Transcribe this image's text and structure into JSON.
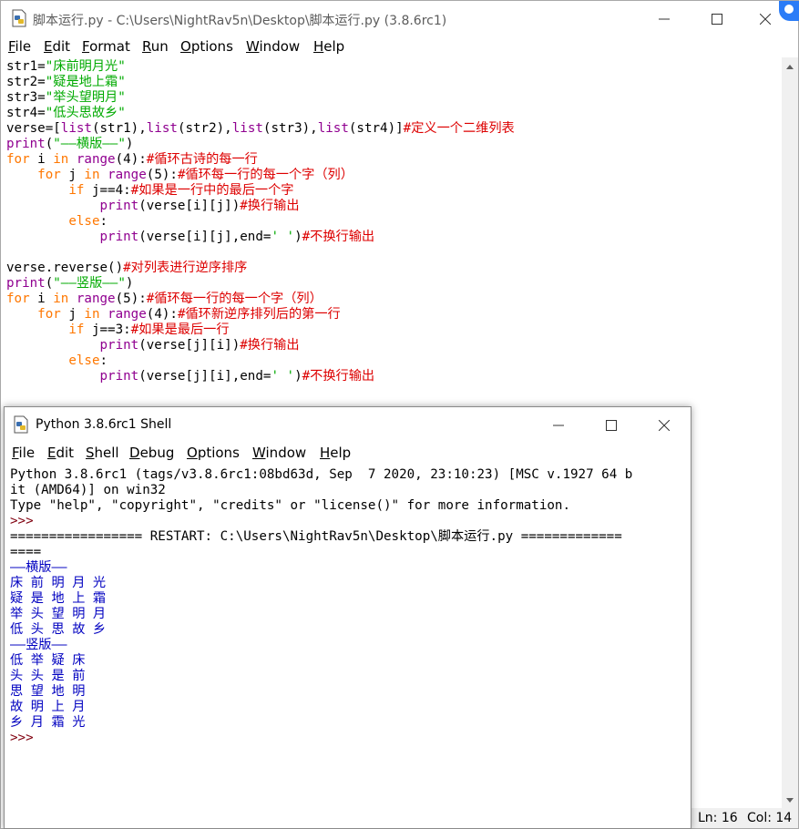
{
  "editor": {
    "title": "脚本运行.py - C:\\Users\\NightRav5n\\Desktop\\脚本运行.py (3.8.6rc1)",
    "menu": [
      "File",
      "Edit",
      "Format",
      "Run",
      "Options",
      "Window",
      "Help"
    ],
    "status": {
      "line": "Ln: 16",
      "col": "Col: 14"
    },
    "code": [
      [
        [
          "",
          "str1="
        ],
        [
          "st",
          "\"床前明月光\""
        ]
      ],
      [
        [
          "",
          "str2="
        ],
        [
          "st",
          "\"疑是地上霜\""
        ]
      ],
      [
        [
          "",
          "str3="
        ],
        [
          "st",
          "\"举头望明月\""
        ]
      ],
      [
        [
          "",
          "str4="
        ],
        [
          "st",
          "\"低头思故乡\""
        ]
      ],
      [
        [
          "",
          "verse=["
        ],
        [
          "bi",
          "list"
        ],
        [
          "",
          "(str1),"
        ],
        [
          "bi",
          "list"
        ],
        [
          "",
          "(str2),"
        ],
        [
          "bi",
          "list"
        ],
        [
          "",
          "(str3),"
        ],
        [
          "bi",
          "list"
        ],
        [
          "",
          "(str4)]"
        ],
        [
          "cm",
          "#定义一个二维列表"
        ]
      ],
      [
        [
          "bi",
          "print"
        ],
        [
          "",
          "("
        ],
        [
          "st",
          "\"——横版——\""
        ],
        [
          "",
          ")"
        ]
      ],
      [
        [
          "kw",
          "for"
        ],
        [
          "",
          " i "
        ],
        [
          "kw",
          "in"
        ],
        [
          "",
          " "
        ],
        [
          "bi",
          "range"
        ],
        [
          "",
          "(4):"
        ],
        [
          "cm",
          "#循环古诗的每一行"
        ]
      ],
      [
        [
          "",
          "    "
        ],
        [
          "kw",
          "for"
        ],
        [
          "",
          " j "
        ],
        [
          "kw",
          "in"
        ],
        [
          "",
          " "
        ],
        [
          "bi",
          "range"
        ],
        [
          "",
          "(5):"
        ],
        [
          "cm",
          "#循环每一行的每一个字（列）"
        ]
      ],
      [
        [
          "",
          "        "
        ],
        [
          "kw",
          "if"
        ],
        [
          "",
          " j==4:"
        ],
        [
          "cm",
          "#如果是一行中的最后一个字"
        ]
      ],
      [
        [
          "",
          "            "
        ],
        [
          "bi",
          "print"
        ],
        [
          "",
          "(verse[i][j])"
        ],
        [
          "cm",
          "#换行输出"
        ]
      ],
      [
        [
          "",
          "        "
        ],
        [
          "kw",
          "else"
        ],
        [
          "",
          ":"
        ]
      ],
      [
        [
          "",
          "            "
        ],
        [
          "bi",
          "print"
        ],
        [
          "",
          "(verse[i][j],end="
        ],
        [
          "st",
          "' '"
        ],
        [
          "",
          ")"
        ],
        [
          "cm",
          "#不换行输出"
        ]
      ],
      [
        [
          "",
          ""
        ]
      ],
      [
        [
          "",
          "verse.reverse()"
        ],
        [
          "cm",
          "#对列表进行逆序排序"
        ]
      ],
      [
        [
          "bi",
          "print"
        ],
        [
          "",
          "("
        ],
        [
          "st",
          "\"——竖版——\""
        ],
        [
          "",
          ")"
        ]
      ],
      [
        [
          "kw",
          "for"
        ],
        [
          "",
          " i "
        ],
        [
          "kw",
          "in"
        ],
        [
          "",
          " "
        ],
        [
          "bi",
          "range"
        ],
        [
          "",
          "(5):"
        ],
        [
          "cm",
          "#循环每一行的每一个字（列）"
        ]
      ],
      [
        [
          "",
          "    "
        ],
        [
          "kw",
          "for"
        ],
        [
          "",
          " j "
        ],
        [
          "kw",
          "in"
        ],
        [
          "",
          " "
        ],
        [
          "bi",
          "range"
        ],
        [
          "",
          "(4):"
        ],
        [
          "cm",
          "#循环新逆序排列后的第一行"
        ]
      ],
      [
        [
          "",
          "        "
        ],
        [
          "kw",
          "if"
        ],
        [
          "",
          " j==3:"
        ],
        [
          "cm",
          "#如果是最后一行"
        ]
      ],
      [
        [
          "",
          "            "
        ],
        [
          "bi",
          "print"
        ],
        [
          "",
          "(verse[j][i])"
        ],
        [
          "cm",
          "#换行输出"
        ]
      ],
      [
        [
          "",
          "        "
        ],
        [
          "kw",
          "else"
        ],
        [
          "",
          ":"
        ]
      ],
      [
        [
          "",
          "            "
        ],
        [
          "bi",
          "print"
        ],
        [
          "",
          "(verse[j][i],end="
        ],
        [
          "st",
          "' '"
        ],
        [
          "",
          ")"
        ],
        [
          "cm",
          "#不换行输出"
        ]
      ]
    ]
  },
  "shell": {
    "title": "Python 3.8.6rc1 Shell",
    "menu": [
      "File",
      "Edit",
      "Shell",
      "Debug",
      "Options",
      "Window",
      "Help"
    ],
    "output": [
      [
        "",
        "Python 3.8.6rc1 (tags/v3.8.6rc1:08bd63d, Sep  7 2020, 23:10:23) [MSC v.1927 64 b"
      ],
      [
        "",
        "it (AMD64)] on win32"
      ],
      [
        "",
        "Type \"help\", \"copyright\", \"credits\" or \"license()\" for more information."
      ],
      [
        "prompt",
        ">>> "
      ],
      [
        "",
        "================= RESTART: C:\\Users\\NightRav5n\\Desktop\\脚本运行.py ============="
      ],
      [
        "",
        "===="
      ],
      [
        "stdout",
        "——横版——"
      ],
      [
        "stdout",
        "床 前 明 月 光"
      ],
      [
        "stdout",
        "疑 是 地 上 霜"
      ],
      [
        "stdout",
        "举 头 望 明 月"
      ],
      [
        "stdout",
        "低 头 思 故 乡"
      ],
      [
        "stdout",
        "——竖版——"
      ],
      [
        "stdout",
        "低 举 疑 床"
      ],
      [
        "stdout",
        "头 头 是 前"
      ],
      [
        "stdout",
        "思 望 地 明"
      ],
      [
        "stdout",
        "故 明 上 月"
      ],
      [
        "stdout",
        "乡 月 霜 光"
      ],
      [
        "prompt",
        ">>> "
      ]
    ]
  },
  "colors": {
    "keyword": "#ff7700",
    "builtin": "#900090",
    "string": "#00aa00",
    "comment": "#dd0000",
    "stdout": "#0000c0",
    "prompt": "#80000f"
  },
  "icons": {
    "app": "python-idle-icon",
    "minimize": "minimize-icon",
    "maximize": "maximize-icon",
    "close": "close-icon"
  }
}
